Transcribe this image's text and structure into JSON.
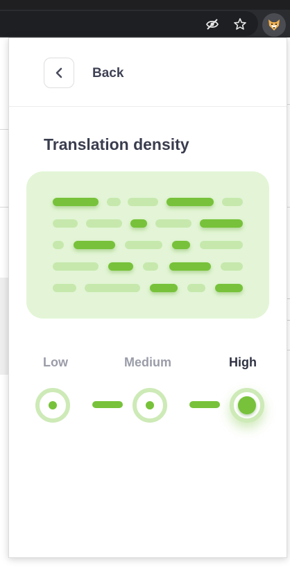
{
  "browser": {
    "icons": [
      "eye-off-icon",
      "star-icon",
      "fox-extension-icon"
    ]
  },
  "popup": {
    "back_label": "Back",
    "title": "Translation density",
    "levels": [
      {
        "label": "Low",
        "selected": false
      },
      {
        "label": "Medium",
        "selected": false
      },
      {
        "label": "High",
        "selected": true
      }
    ]
  },
  "colors": {
    "accent": "#77c23a",
    "accent_light": "#c6e8ad",
    "preview_bg": "#e3f5d6",
    "title_text": "#3a3d4e",
    "muted_text": "#9a9ca8"
  }
}
